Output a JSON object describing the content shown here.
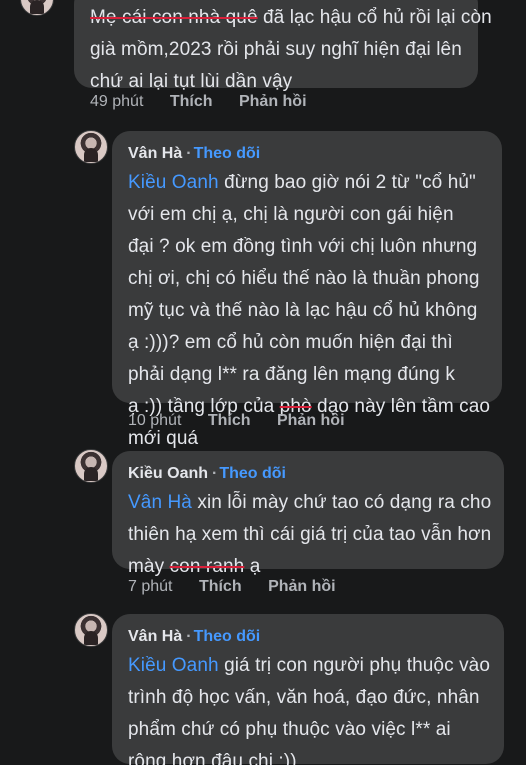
{
  "comments": [
    {
      "id": "c0",
      "lines": [
        {
          "parts": [
            {
              "t": "Mẹ cái con nhà quê",
              "s": "strike"
            },
            {
              "t": " đã lạc hậu cổ hủ rồi lại còn"
            }
          ]
        },
        {
          "parts": [
            {
              "t": "già mồm,2023 rồi phải suy nghĩ hiện đại lên"
            }
          ]
        },
        {
          "parts": [
            {
              "t": "chứ ai lại tụt lùi dần vậy"
            }
          ]
        }
      ],
      "time": "49 phút",
      "like": "Thích",
      "reply": "Phản hồi"
    },
    {
      "id": "c1",
      "author": "Vân Hà",
      "follow": "Theo dõi",
      "lines": [
        {
          "parts": [
            {
              "t": "Kiều Oanh",
              "s": "mention"
            },
            {
              "t": " đừng bao giờ nói 2 từ \"cổ hủ\""
            }
          ]
        },
        {
          "parts": [
            {
              "t": "với em chị ạ, chị là người con gái hiện"
            }
          ]
        },
        {
          "parts": [
            {
              "t": "đại ? ok em đồng tình với chị luôn nhưng"
            }
          ]
        },
        {
          "parts": [
            {
              "t": "chị ơi, chị có hiểu thế nào là thuần phong"
            }
          ]
        },
        {
          "parts": [
            {
              "t": "mỹ tục và thế nào là lạc hậu cổ hủ không"
            }
          ]
        },
        {
          "parts": [
            {
              "t": "ạ :)))? em cổ hủ còn muốn hiện đại thì"
            }
          ]
        },
        {
          "parts": [
            {
              "t": "phải dạng l** ra đăng lên mạng đúng k"
            }
          ]
        },
        {
          "parts": [
            {
              "t": "ạ :)) tầng lớp của "
            },
            {
              "t": "phò",
              "s": "strike"
            },
            {
              "t": " dạo này lên tầm cao"
            }
          ]
        },
        {
          "parts": [
            {
              "t": "mới quá"
            }
          ]
        }
      ],
      "time": "10 phút",
      "like": "Thích",
      "reply": "Phản hồi"
    },
    {
      "id": "c2",
      "author": "Kiều Oanh",
      "follow": "Theo dõi",
      "lines": [
        {
          "parts": [
            {
              "t": "Vân Hà",
              "s": "mention"
            },
            {
              "t": " xin lỗi mày chứ tao có dạng ra cho"
            }
          ]
        },
        {
          "parts": [
            {
              "t": "thiên hạ xem thì cái giá trị của tao vẫn hơn"
            }
          ]
        },
        {
          "parts": [
            {
              "t": "mày "
            },
            {
              "t": "con ranh",
              "s": "strike"
            },
            {
              "t": " ạ"
            }
          ]
        }
      ],
      "time": "7 phút",
      "like": "Thích",
      "reply": "Phản hồi"
    },
    {
      "id": "c3",
      "author": "Vân Hà",
      "follow": "Theo dõi",
      "lines": [
        {
          "parts": [
            {
              "t": "Kiều Oanh",
              "s": "mention"
            },
            {
              "t": " giá trị con người phụ thuộc vào"
            }
          ]
        },
        {
          "parts": [
            {
              "t": "trình độ học vấn, văn hoá, đạo đức, nhân"
            }
          ]
        },
        {
          "parts": [
            {
              "t": "phẩm chứ có phụ thuộc vào việc l** ai"
            }
          ]
        },
        {
          "parts": [
            {
              "t": "rộng hơn đâu chị :))"
            }
          ]
        }
      ]
    }
  ]
}
